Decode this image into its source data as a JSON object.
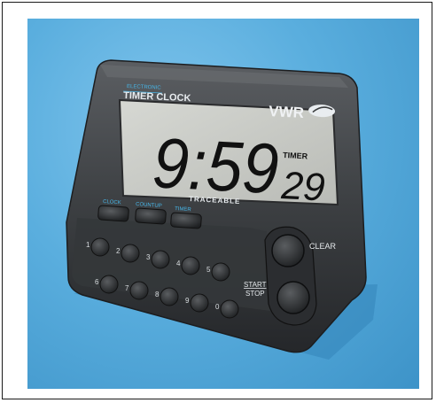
{
  "device": {
    "top_small_label": "ELECTRONIC",
    "model_label": "TIMER CLOCK",
    "brand": "VWR",
    "display": {
      "main_digits": "9:59",
      "seconds_digits": "29",
      "mode_label": "TIMER"
    },
    "certification": "TRACEABLE",
    "mode_buttons": [
      "CLOCK",
      "COUNTUP",
      "TIMER"
    ],
    "keypad": [
      "1",
      "2",
      "3",
      "4",
      "5",
      "6",
      "7",
      "8",
      "9",
      "0"
    ],
    "clear_label": "CLEAR",
    "start_label": "START",
    "stop_label": "STOP"
  },
  "colors": {
    "background": "#5aaede",
    "body": "#3a3c3e",
    "lcd": "#c9cbc6",
    "accent_text": "#47b5e6"
  }
}
